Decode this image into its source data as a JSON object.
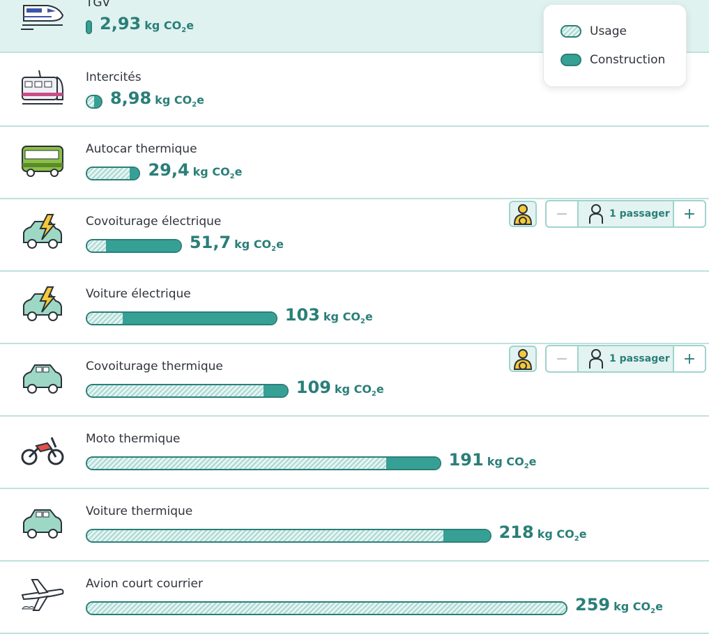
{
  "legend": {
    "usage_label": "Usage",
    "construction_label": "Construction"
  },
  "unit": {
    "kg": "kg",
    "co2": "CO",
    "sub": "2",
    "e": "e"
  },
  "passenger_control": {
    "label": "1 passager",
    "minus": "−",
    "plus": "+"
  },
  "colors": {
    "accent": "#2a7f78",
    "construction": "#36a095",
    "usage_hatch": "#a8d8d3",
    "divider": "#bfe1dd",
    "highlight": "#dff2f0"
  },
  "chart_data": {
    "type": "bar",
    "orientation": "horizontal",
    "stacked": true,
    "unit": "kg CO₂e",
    "categories": [
      "TGV",
      "Intercités",
      "Autocar thermique",
      "Covoiturage électrique",
      "Voiture électrique",
      "Covoiturage thermique",
      "Moto thermique",
      "Voiture thermique",
      "Avion court courrier"
    ],
    "value_labels": [
      "2,93",
      "8,98",
      "29,4",
      "51,7",
      "103",
      "109",
      "191",
      "218",
      "259"
    ],
    "totals": [
      2.93,
      8.98,
      29.4,
      51.7,
      103,
      109,
      191,
      218,
      259
    ],
    "series": [
      {
        "name": "Usage",
        "values": [
          0,
          4.5,
          24.2,
          10.5,
          19.4,
          96,
          162,
          193,
          259
        ]
      },
      {
        "name": "Construction",
        "values": [
          2.93,
          4.48,
          5.2,
          41.2,
          83.6,
          13,
          29,
          25,
          0
        ]
      }
    ],
    "icons": [
      "tgv-train-icon",
      "intercites-train-icon",
      "bus-icon",
      "electric-car-icon",
      "electric-car-icon",
      "car-icon",
      "motorcycle-icon",
      "car-icon",
      "airplane-icon"
    ],
    "highlighted": "TGV",
    "legend_position": "top-right"
  }
}
